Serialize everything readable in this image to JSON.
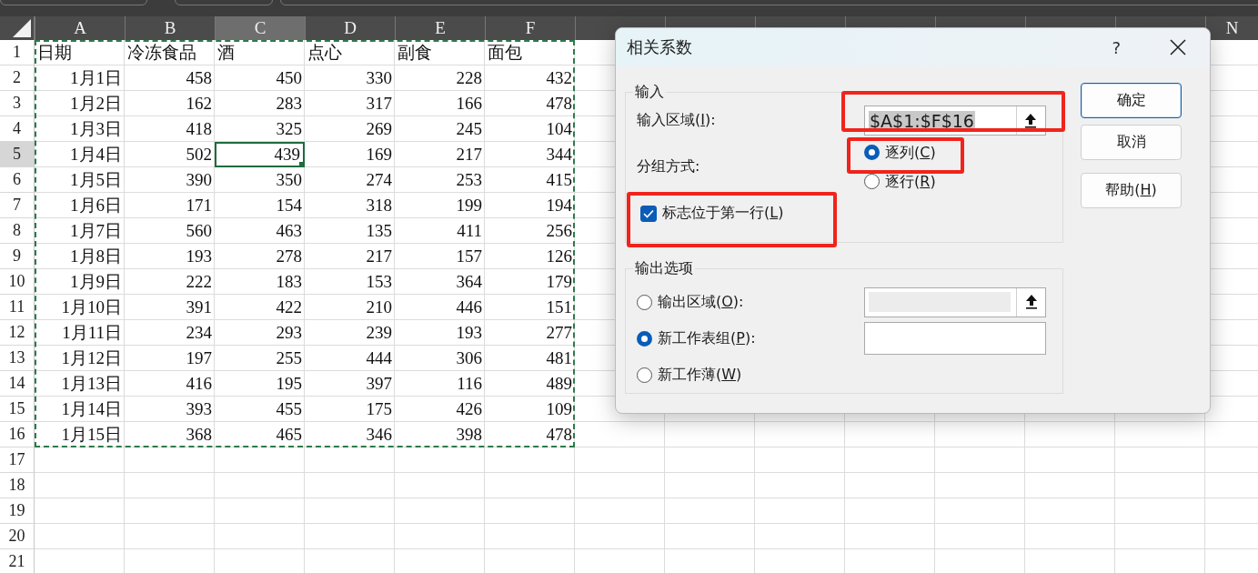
{
  "sheet": {
    "columns": [
      {
        "label": "A",
        "selected": false
      },
      {
        "label": "B",
        "selected": false
      },
      {
        "label": "C",
        "selected": true
      },
      {
        "label": "D",
        "selected": false
      },
      {
        "label": "E",
        "selected": false
      },
      {
        "label": "F",
        "selected": false
      },
      {
        "selected": false
      },
      {
        "selected": false
      },
      {
        "selected": false
      },
      {
        "selected": false
      },
      {
        "selected": false
      },
      {
        "selected": false
      },
      {
        "selected": false
      },
      {
        "label": "N",
        "selected": false
      }
    ],
    "rows": [
      {
        "number": "1",
        "selected": false,
        "cells": [
          "日期",
          "冷冻食品",
          "酒",
          "点心",
          "副食",
          "面包"
        ]
      },
      {
        "number": "2",
        "selected": false,
        "cells": [
          "1月1日",
          "458",
          "450",
          "330",
          "228",
          "432"
        ]
      },
      {
        "number": "3",
        "selected": false,
        "cells": [
          "1月2日",
          "162",
          "283",
          "317",
          "166",
          "478"
        ]
      },
      {
        "number": "4",
        "selected": false,
        "cells": [
          "1月3日",
          "418",
          "325",
          "269",
          "245",
          "104"
        ]
      },
      {
        "number": "5",
        "selected": true,
        "cells": [
          "1月4日",
          "502",
          "439",
          "169",
          "217",
          "344"
        ]
      },
      {
        "number": "6",
        "selected": false,
        "cells": [
          "1月5日",
          "390",
          "350",
          "274",
          "253",
          "415"
        ]
      },
      {
        "number": "7",
        "selected": false,
        "cells": [
          "1月6日",
          "171",
          "154",
          "318",
          "199",
          "194"
        ]
      },
      {
        "number": "8",
        "selected": false,
        "cells": [
          "1月7日",
          "560",
          "463",
          "135",
          "411",
          "256"
        ]
      },
      {
        "number": "9",
        "selected": false,
        "cells": [
          "1月8日",
          "193",
          "278",
          "217",
          "157",
          "126"
        ]
      },
      {
        "number": "10",
        "selected": false,
        "cells": [
          "1月9日",
          "222",
          "183",
          "153",
          "364",
          "179"
        ]
      },
      {
        "number": "11",
        "selected": false,
        "cells": [
          "1月10日",
          "391",
          "422",
          "210",
          "446",
          "151"
        ]
      },
      {
        "number": "12",
        "selected": false,
        "cells": [
          "1月11日",
          "234",
          "293",
          "239",
          "193",
          "277"
        ]
      },
      {
        "number": "13",
        "selected": false,
        "cells": [
          "1月12日",
          "197",
          "255",
          "444",
          "306",
          "481"
        ]
      },
      {
        "number": "14",
        "selected": false,
        "cells": [
          "1月13日",
          "416",
          "195",
          "397",
          "116",
          "489"
        ]
      },
      {
        "number": "15",
        "selected": false,
        "cells": [
          "1月14日",
          "393",
          "455",
          "175",
          "426",
          "109"
        ]
      },
      {
        "number": "16",
        "selected": false,
        "cells": [
          "1月15日",
          "368",
          "465",
          "346",
          "398",
          "478"
        ]
      },
      {
        "number": "17",
        "selected": false
      },
      {
        "number": "18",
        "selected": false
      },
      {
        "number": "19",
        "selected": false
      },
      {
        "number": "20",
        "selected": false
      },
      {
        "number": "21",
        "selected": false
      }
    ]
  },
  "dialog": {
    "title": "相关系数",
    "help": "?",
    "input": {
      "legend": "输入",
      "range_label": "输入区域(I):",
      "range_value": "$A$1:$F$16",
      "value_selected": true,
      "grouping_label": "分组方式:",
      "grouping": [
        {
          "label": "逐列(C)",
          "selected": true
        },
        {
          "label": "逐行(R)",
          "selected": false
        }
      ],
      "header_checkbox": {
        "label": "标志位于第一行(L)",
        "checked": true
      }
    },
    "output": {
      "legend": "输出选项",
      "options": [
        {
          "label": "输出区域(O):",
          "selected": false,
          "kind": "range",
          "disabled": true
        },
        {
          "label": "新工作表组(P):",
          "selected": true,
          "kind": "text",
          "disabled": false
        },
        {
          "label": "新工作薄(W)",
          "selected": false,
          "kind": "none"
        }
      ]
    },
    "buttons": [
      {
        "label": "确定",
        "default": true
      },
      {
        "label": "取消",
        "default": false
      },
      {
        "label": "帮助(H)",
        "default": false
      }
    ]
  }
}
